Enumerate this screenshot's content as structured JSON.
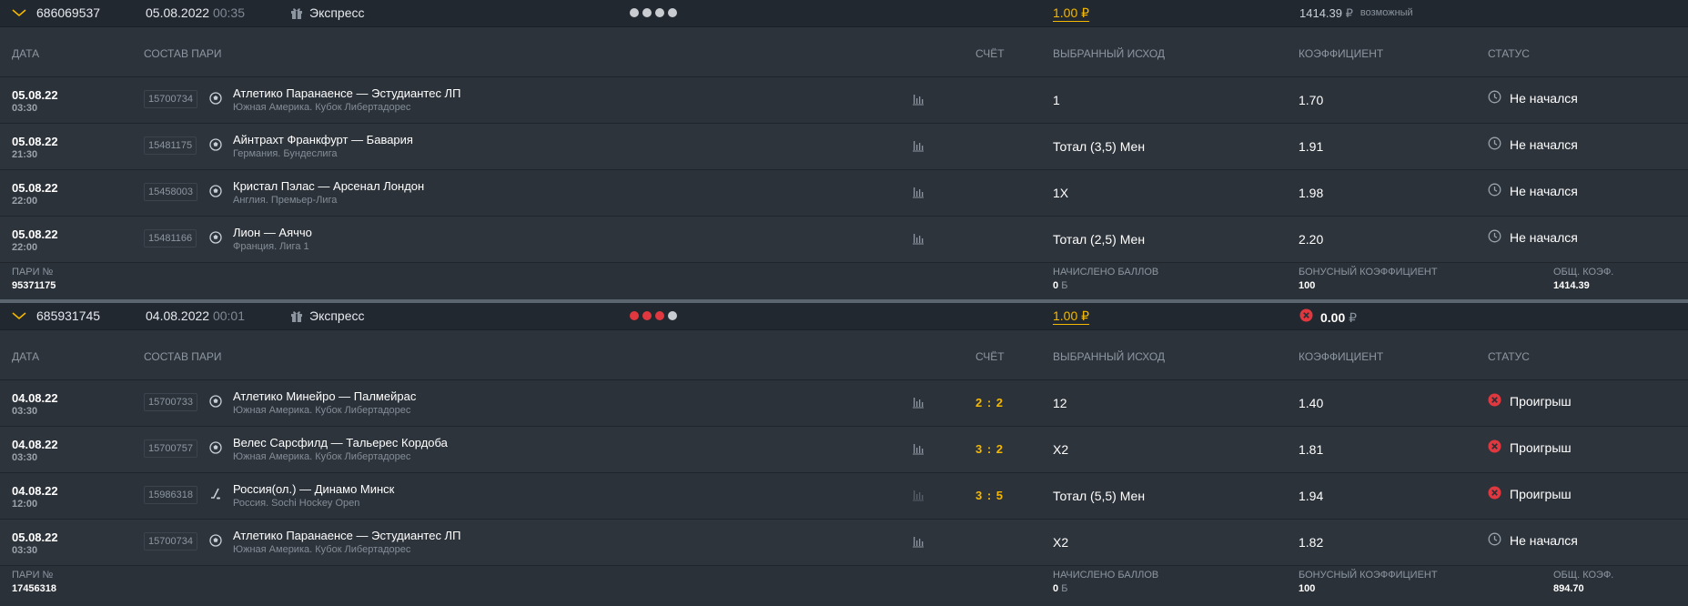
{
  "columns": {
    "date": "ДАТА",
    "match": "СОСТАВ ПАРИ",
    "score": "СЧЁТ",
    "pick": "ВЫБРАННЫЙ ИСХОД",
    "odds": "КОЭФФИЦИЕНТ",
    "status": "СТАТУС"
  },
  "footer_labels": {
    "bet_no": "ПАРИ №",
    "points": "НАЧИСЛЕНО БАЛЛОВ",
    "bonus": "БОНУСНЫЙ КОЭФФИЦИЕНТ",
    "total": "ОБЩ. КОЭФ."
  },
  "colors": {
    "accent": "#f5b800",
    "loss": "#e0383e",
    "dot_grey": "#c9ccd1"
  },
  "bets": [
    {
      "id": "686069537",
      "date": "05.08.2022",
      "time": "00:35",
      "type": "Экспресс",
      "dots": [
        "grey",
        "grey",
        "grey",
        "grey"
      ],
      "stake": "1.00 ₽",
      "win_amount": "1414.39",
      "win_currency": "₽",
      "win_note": "возможный",
      "events": [
        {
          "date": "05.08.22",
          "time": "03:30",
          "code": "15700734",
          "sport": "football-icon",
          "match": "Атлетико Паранаенсе — Эстудиантес ЛП",
          "league": "Южная Америка. Кубок Либертадорес",
          "score": "",
          "pick": "1",
          "odds": "1.70",
          "status": "Не начался",
          "status_icon": "clock-icon"
        },
        {
          "date": "05.08.22",
          "time": "21:30",
          "code": "15481175",
          "sport": "football-icon",
          "match": "Айнтрахт Франкфурт — Бавария",
          "league": "Германия. Бундеслига",
          "score": "",
          "pick": "Тотал (3,5) Мен",
          "odds": "1.91",
          "status": "Не начался",
          "status_icon": "clock-icon"
        },
        {
          "date": "05.08.22",
          "time": "22:00",
          "code": "15458003",
          "sport": "football-icon",
          "match": "Кристал Пэлас — Арсенал Лондон",
          "league": "Англия. Премьер-Лига",
          "score": "",
          "pick": "1X",
          "odds": "1.98",
          "status": "Не начался",
          "status_icon": "clock-icon"
        },
        {
          "date": "05.08.22",
          "time": "22:00",
          "code": "15481166",
          "sport": "football-icon",
          "match": "Лион — Аяччо",
          "league": "Франция. Лига 1",
          "score": "",
          "pick": "Тотал (2,5) Мен",
          "odds": "2.20",
          "status": "Не начался",
          "status_icon": "clock-icon"
        }
      ],
      "bet_no": "95371175",
      "points": "0",
      "points_cur": "Б",
      "bonus": "100",
      "total": "1414.39"
    },
    {
      "id": "685931745",
      "date": "04.08.2022",
      "time": "00:01",
      "type": "Экспресс",
      "dots": [
        "red",
        "red",
        "red",
        "grey"
      ],
      "stake": "1.00 ₽",
      "lost_amount": "0.00",
      "lost_currency": "₽",
      "events": [
        {
          "date": "04.08.22",
          "time": "03:30",
          "code": "15700733",
          "sport": "football-icon",
          "match": "Атлетико Минейро — Палмейрас",
          "league": "Южная Америка. Кубок Либертадорес",
          "score": "2 : 2",
          "pick": "12",
          "odds": "1.40",
          "status": "Проигрыш",
          "status_icon": "loss-icon"
        },
        {
          "date": "04.08.22",
          "time": "03:30",
          "code": "15700757",
          "sport": "football-icon",
          "match": "Велес Сарсфилд — Тальерес Кордоба",
          "league": "Южная Америка. Кубок Либертадорес",
          "score": "3 : 2",
          "pick": "Х2",
          "odds": "1.81",
          "status": "Проигрыш",
          "status_icon": "loss-icon"
        },
        {
          "date": "04.08.22",
          "time": "12:00",
          "code": "15986318",
          "sport": "hockey-icon",
          "match": "Россия(ол.) — Динамо Минск",
          "league": "Россия. Sochi Hockey Open",
          "score": "3 : 5",
          "pick": "Тотал (5,5) Мен",
          "odds": "1.94",
          "status": "Проигрыш",
          "status_icon": "loss-icon"
        },
        {
          "date": "05.08.22",
          "time": "03:30",
          "code": "15700734",
          "sport": "football-icon",
          "match": "Атлетико Паранаенсе — Эстудиантес ЛП",
          "league": "Южная Америка. Кубок Либертадорес",
          "score": "",
          "pick": "Х2",
          "odds": "1.82",
          "status": "Не начался",
          "status_icon": "clock-icon"
        }
      ],
      "bet_no": "17456318",
      "points": "0",
      "points_cur": "Б",
      "bonus": "100",
      "total": "894.70"
    }
  ]
}
